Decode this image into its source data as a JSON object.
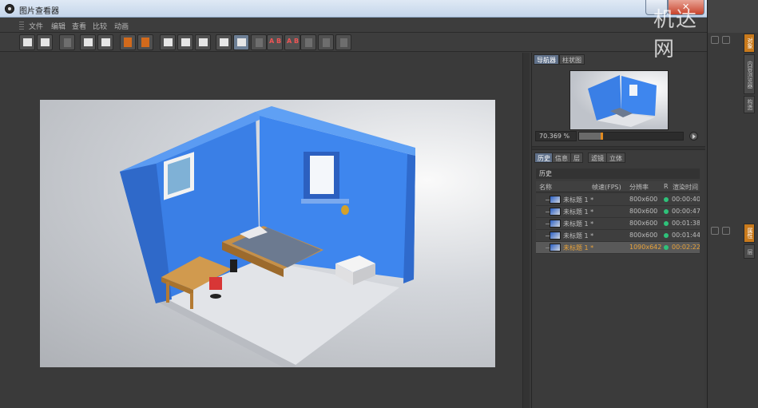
{
  "window": {
    "title": "图片查看器"
  },
  "watermark": "机达网",
  "menu": [
    "文件",
    "编辑",
    "查看",
    "比较",
    "动画"
  ],
  "toolbar_icons": [
    "open-icon",
    "save-icon",
    "grid-icon",
    "render-icon",
    "render-settings-icon",
    "copy-orange-icon",
    "paste-orange-icon",
    "frame-a-icon",
    "frame-b-icon",
    "region-icon",
    "compare-icon",
    "split-selected-icon",
    "split-icon",
    "set-a-icon",
    "set-b-icon",
    "swap-icon",
    "ab-icon",
    "ab-split-icon"
  ],
  "navigator": {
    "tabs": [
      "导航器",
      "柱状图"
    ],
    "zoom": "70.369 %",
    "zoom_fraction": 0.21
  },
  "history": {
    "tabs": [
      "历史",
      "信息",
      "层",
      "滤镜",
      "立体"
    ],
    "title": "历史",
    "columns": [
      "名称",
      "帧速(FPS)",
      "分辨率",
      "R",
      "渲染时间"
    ],
    "rows": [
      {
        "name": "未标题 1 *",
        "resolution": "800x600",
        "time": "00:00:40",
        "selected": false
      },
      {
        "name": "未标题 1 *",
        "resolution": "800x600",
        "time": "00:00:47",
        "selected": false
      },
      {
        "name": "未标题 1 *",
        "resolution": "800x600",
        "time": "00:01:38",
        "selected": false
      },
      {
        "name": "未标题 1 *",
        "resolution": "800x600",
        "time": "00:01:44",
        "selected": false
      },
      {
        "name": "未标题 1 *",
        "resolution": "1090x642",
        "time": "00:02:22",
        "selected": true
      }
    ]
  },
  "side_tabs": [
    "对象",
    "内容浏览器",
    "构造",
    "属性",
    "层"
  ],
  "colors": {
    "accent": "#e08a20",
    "selection": "#5f7089",
    "status_ok": "#2ec27a",
    "wall_blue": "#3a7fe6"
  }
}
